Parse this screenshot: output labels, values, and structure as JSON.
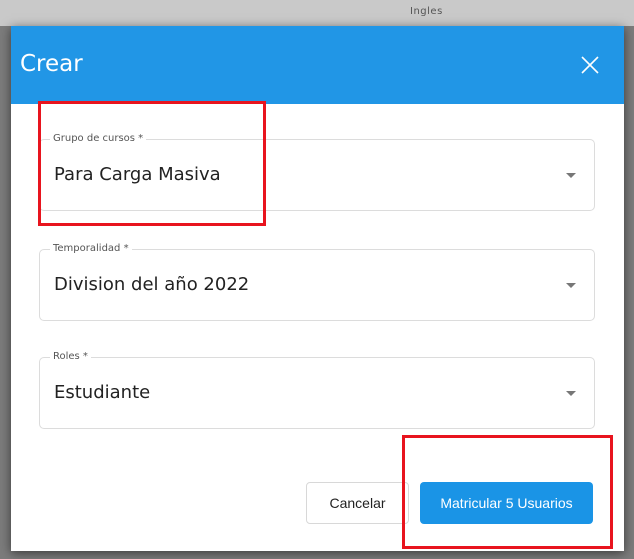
{
  "backdrop": {
    "text": "Ingles"
  },
  "dialog": {
    "title": "Crear",
    "fields": [
      {
        "label": "Grupo de cursos *",
        "value": "Para Carga Masiva"
      },
      {
        "label": "Temporalidad *",
        "value": "Division del año 2022"
      },
      {
        "label": "Roles *",
        "value": "Estudiante"
      }
    ],
    "buttons": {
      "cancel": "Cancelar",
      "submit": "Matricular 5 Usuarios"
    }
  },
  "colors": {
    "header": "#2196e6",
    "primary_button": "#1a94e6",
    "highlight": "#e8141e"
  },
  "icons": {
    "close": "close-icon",
    "dropdown": "caret-down-icon"
  }
}
